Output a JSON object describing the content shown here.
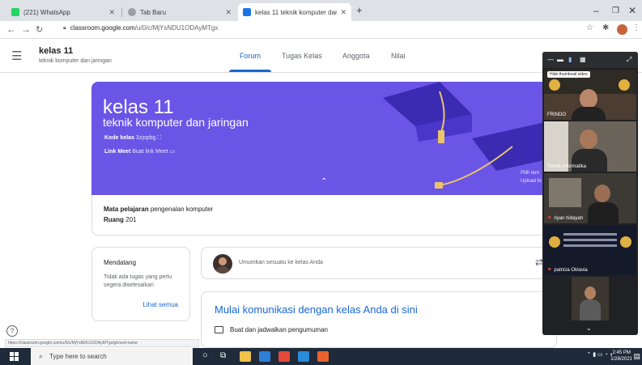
{
  "browser": {
    "tabs": [
      {
        "title": "(221) WhatsApp",
        "fav_color": "#25d366"
      },
      {
        "title": "Tab Baru",
        "fav_color": "#9aa0a6"
      },
      {
        "title": "kelas 11 teknik komputer dan jar",
        "fav_color": "#1a73e8"
      }
    ],
    "new_tab": "+",
    "url_domain": "classroom.google.com",
    "url_path": "/u/0/c/MjYsNDU1ODAyMTgx",
    "status_url": "https://classroom.google.com/u/0/c/MjYsNDU1ODAyMTgx/gb/sort-name"
  },
  "classroom": {
    "title": "kelas 11",
    "subtitle": "teknik komputer dan jaringan",
    "tabs": [
      "Forum",
      "Tugas Kelas",
      "Anggota",
      "Nilai"
    ],
    "banner": {
      "title": "kelas 11",
      "subtitle": "teknik komputer dan jaringan",
      "code_label": "Kode kelas",
      "code_value": "3zjopbg",
      "meet_label": "Link Meet",
      "meet_value": "Buat link Meet",
      "side_line1": "Pilih tem",
      "side_line2": "Upload fo"
    },
    "details": {
      "subject_label": "Mata pelajaran",
      "subject_value": "pengenalan komputer",
      "room_label": "Ruang",
      "room_value": "201"
    },
    "upcoming": {
      "title": "Mendatang",
      "note": "Tidak ada tugas yang perlu segera diselesaikan",
      "link": "Lihat semua"
    },
    "announce_placeholder": "Umumkan sesuatu ke kelas Anda",
    "stream_heading": "Mulai komunikasi dengan kelas Anda di sini",
    "stream_item": "Buat dan jadwalkan pengumuman"
  },
  "meet_panel": {
    "tooltip": "Hide thumbnail video",
    "tiles": [
      {
        "name": "FRINDO",
        "muted": false
      },
      {
        "name": "Teknik informatika",
        "muted": false
      },
      {
        "name": "riyan hidayah",
        "muted": true
      },
      {
        "name": "patricia Oktavia",
        "muted": true
      },
      {
        "name": "",
        "muted": false
      }
    ],
    "muted_symbol": "⚑"
  },
  "taskbar": {
    "search_placeholder": "Type here to search",
    "time": "2:45 PM",
    "date": "1/28/2021"
  }
}
